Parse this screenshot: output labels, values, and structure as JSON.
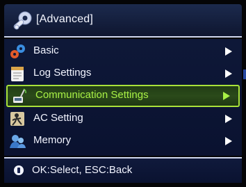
{
  "header": {
    "title": "[Advanced]",
    "icon": "settings-wrench-icon"
  },
  "menu": {
    "items": [
      {
        "label": "Basic",
        "icon": "basic-settings-icon",
        "selected": false
      },
      {
        "label": "Log Settings",
        "icon": "log-settings-icon",
        "selected": false
      },
      {
        "label": "Communication Settings",
        "icon": "communication-icon",
        "selected": true
      },
      {
        "label": "AC Setting",
        "icon": "access-control-icon",
        "selected": false
      },
      {
        "label": "Memory",
        "icon": "memory-icon",
        "selected": false
      }
    ]
  },
  "footer": {
    "hint": "OK:Select, ESC:Back",
    "icon": "info-icon"
  },
  "colors": {
    "accent": "#a9e23a",
    "background": "#0a1230",
    "text": "#f2f4ff"
  }
}
